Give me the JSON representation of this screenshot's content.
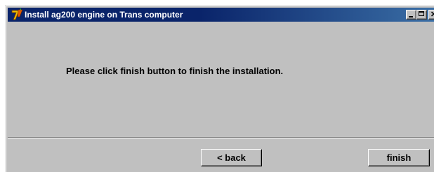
{
  "window": {
    "title": "Install ag200 engine on Trans computer",
    "app_icon": "installer-icon",
    "controls": {
      "minimize": "minimize-icon",
      "maximize": "maximize-icon",
      "close_glyph": "✕"
    }
  },
  "content": {
    "message": "Please click finish button to finish the installation."
  },
  "buttons": {
    "back_label": "< back",
    "finish_label": "finish"
  },
  "colors": {
    "titlebar_start": "#0a246a",
    "titlebar_end": "#3a6ea5",
    "face": "#c0c0c0"
  }
}
